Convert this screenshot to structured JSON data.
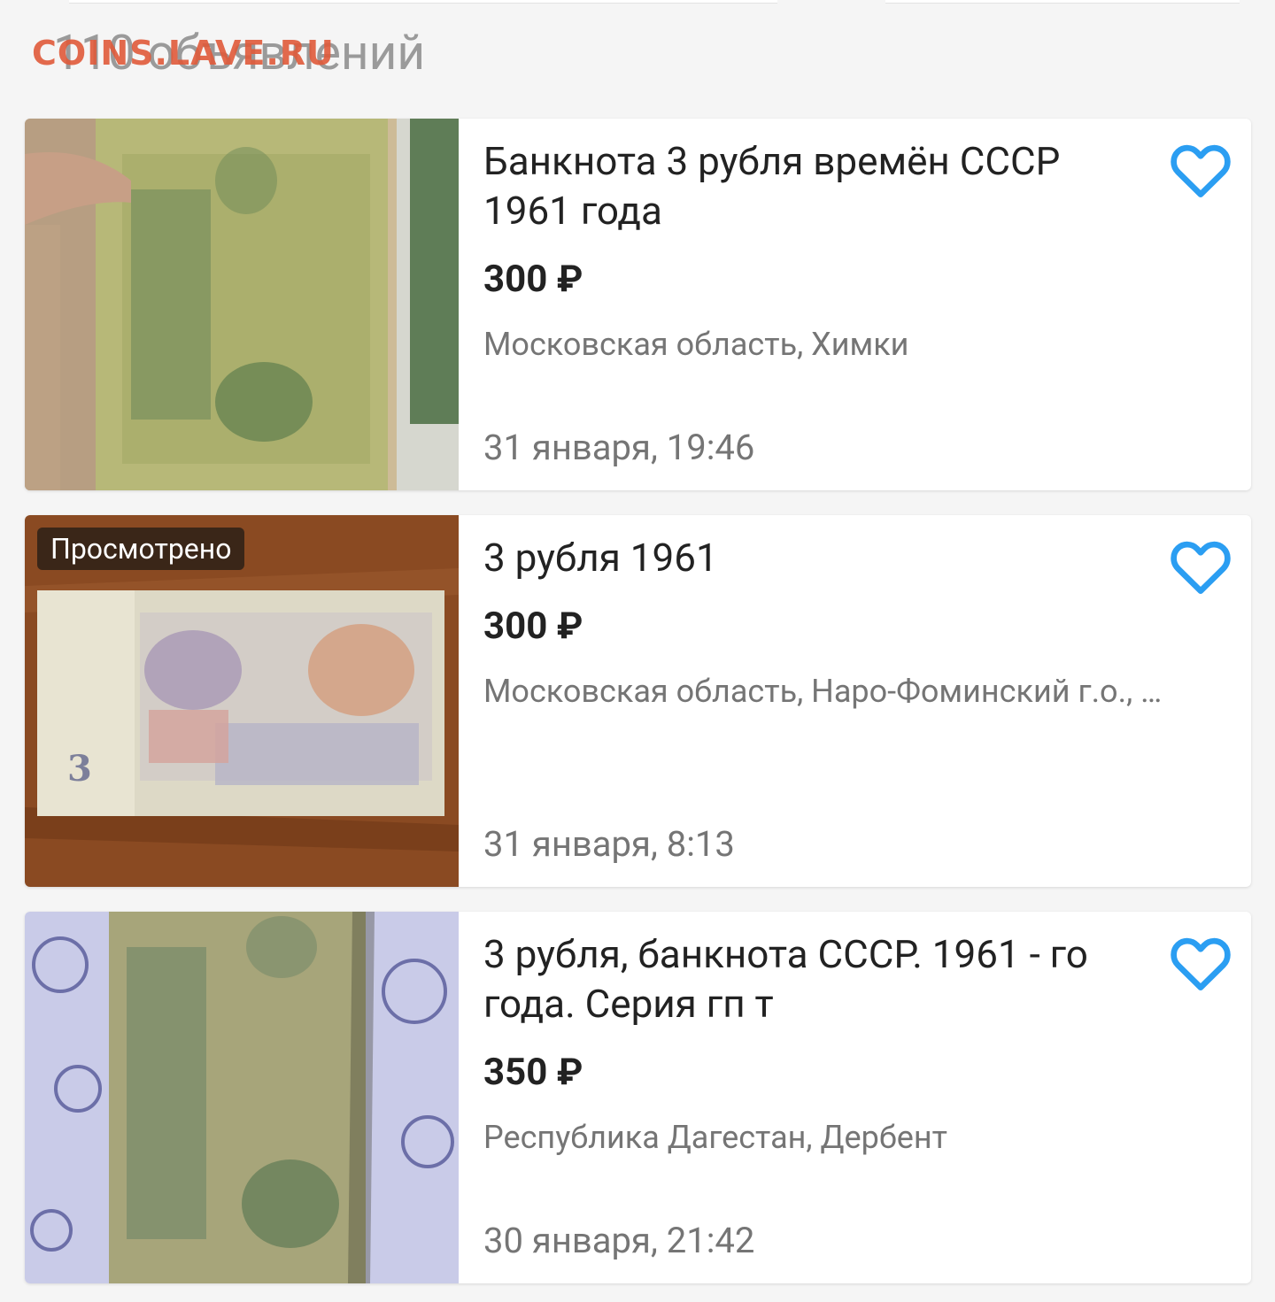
{
  "header": {
    "count_text": "110 объявлений",
    "watermark": "COINS.LAVE.RU"
  },
  "colors": {
    "accent": "#2b9ef2",
    "price": "#222222",
    "secondary_text": "#757575",
    "watermark": "#e05a3a"
  },
  "listings": [
    {
      "title": "Банкнота 3 рубля времён СССР 1961 года",
      "price": "300 ₽",
      "location": "Московская область, Химки",
      "date": "31 января, 19:46",
      "viewed_label": "",
      "favorite_icon": "heart-outline-icon"
    },
    {
      "title": "3 рубля 1961",
      "price": "300 ₽",
      "location": "Московская область, Наро-Фоминский г.о., …",
      "date": "31 января, 8:13",
      "viewed_label": "Просмотрено",
      "favorite_icon": "heart-outline-icon"
    },
    {
      "title": "3 рубля, банкнота СССР. 1961 - го года. Серия гп т",
      "price": "350 ₽",
      "location": "Республика Дагестан, Дербент",
      "date": "30 января, 21:42",
      "viewed_label": "",
      "favorite_icon": "heart-outline-icon"
    }
  ]
}
